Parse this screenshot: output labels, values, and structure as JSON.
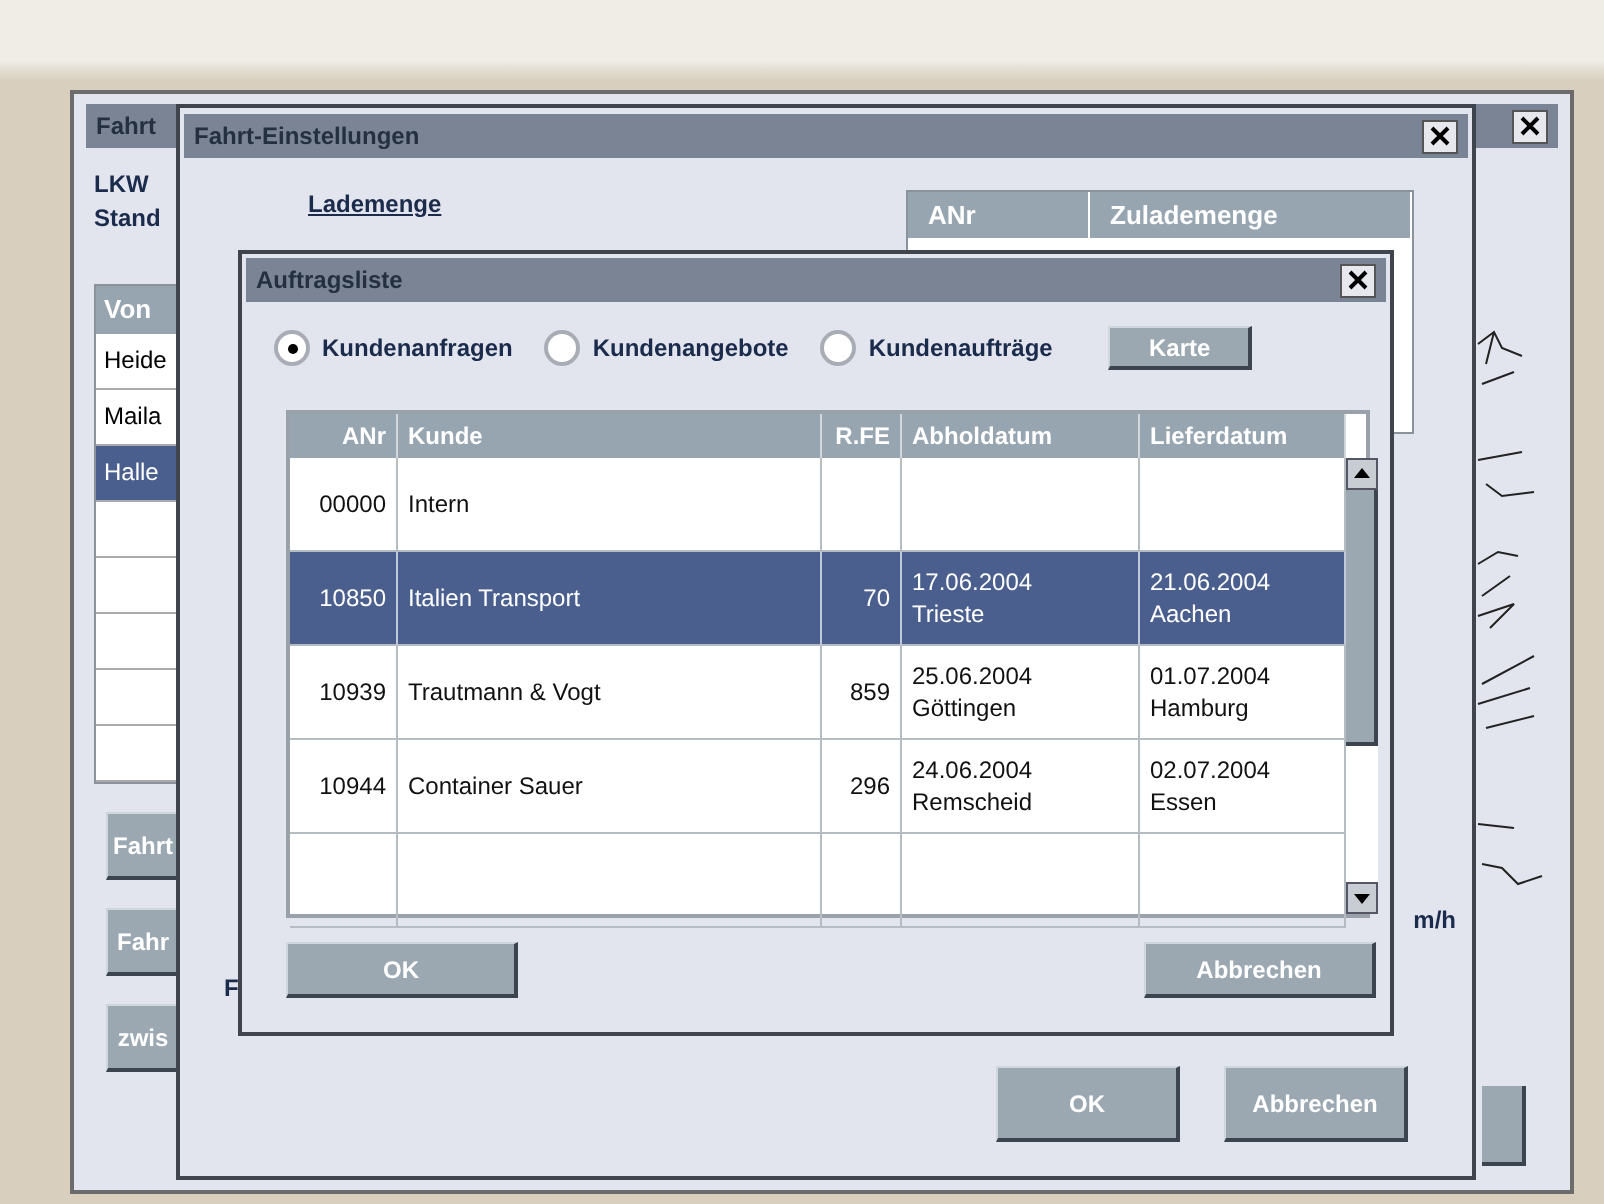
{
  "back_window": {
    "title": "Fahrt",
    "labels": [
      "LKW",
      "Stand"
    ],
    "table": {
      "columns": [
        "Von"
      ],
      "rows": [
        {
          "von": "Heide",
          "selected": false
        },
        {
          "von": "Maila",
          "selected": false
        },
        {
          "von": "Halle",
          "selected": true
        },
        {
          "von": "",
          "selected": false
        },
        {
          "von": "",
          "selected": false
        },
        {
          "von": "",
          "selected": false
        },
        {
          "von": "",
          "selected": false
        },
        {
          "von": "",
          "selected": false
        }
      ]
    },
    "buttons": [
      "Fahrt",
      "Fahr",
      "zwis"
    ]
  },
  "settings_window": {
    "title": "Fahrt-Einstellungen",
    "link": "Lademenge",
    "table": {
      "columns": [
        "ANr",
        "Zulademenge"
      ]
    },
    "label": "F",
    "speed_unit": "m/h",
    "buttons": [
      "OK",
      "Abbrechen"
    ]
  },
  "order_dialog": {
    "title": "Auftragsliste",
    "radios": [
      {
        "label": "Kundenanfragen",
        "selected": true
      },
      {
        "label": "Kundenangebote",
        "selected": false
      },
      {
        "label": "Kundenaufträge",
        "selected": false
      }
    ],
    "map_button": "Karte",
    "table": {
      "columns": [
        "ANr",
        "Kunde",
        "R.FE",
        "Abholdatum",
        "Lieferdatum"
      ],
      "rows": [
        {
          "anr": "00000",
          "kunde": "Intern",
          "rfe": "",
          "pickup_date": "",
          "pickup_place": "",
          "delivery_date": "",
          "delivery_place": "",
          "selected": false
        },
        {
          "anr": "10850",
          "kunde": "Italien Transport",
          "rfe": "70",
          "pickup_date": "17.06.2004",
          "pickup_place": "Trieste",
          "delivery_date": "21.06.2004",
          "delivery_place": "Aachen",
          "selected": true
        },
        {
          "anr": "10939",
          "kunde": "Trautmann & Vogt",
          "rfe": "859",
          "pickup_date": "25.06.2004",
          "pickup_place": "Göttingen",
          "delivery_date": "01.07.2004",
          "delivery_place": "Hamburg",
          "selected": false
        },
        {
          "anr": "10944",
          "kunde": "Container Sauer",
          "rfe": "296",
          "pickup_date": "24.06.2004",
          "pickup_place": "Remscheid",
          "delivery_date": "02.07.2004",
          "delivery_place": "Essen",
          "selected": false
        },
        {
          "anr": "",
          "kunde": "",
          "rfe": "",
          "pickup_date": "",
          "pickup_place": "",
          "delivery_date": "",
          "delivery_place": "",
          "selected": false
        }
      ]
    },
    "buttons": [
      "OK",
      "Abbrechen"
    ]
  }
}
